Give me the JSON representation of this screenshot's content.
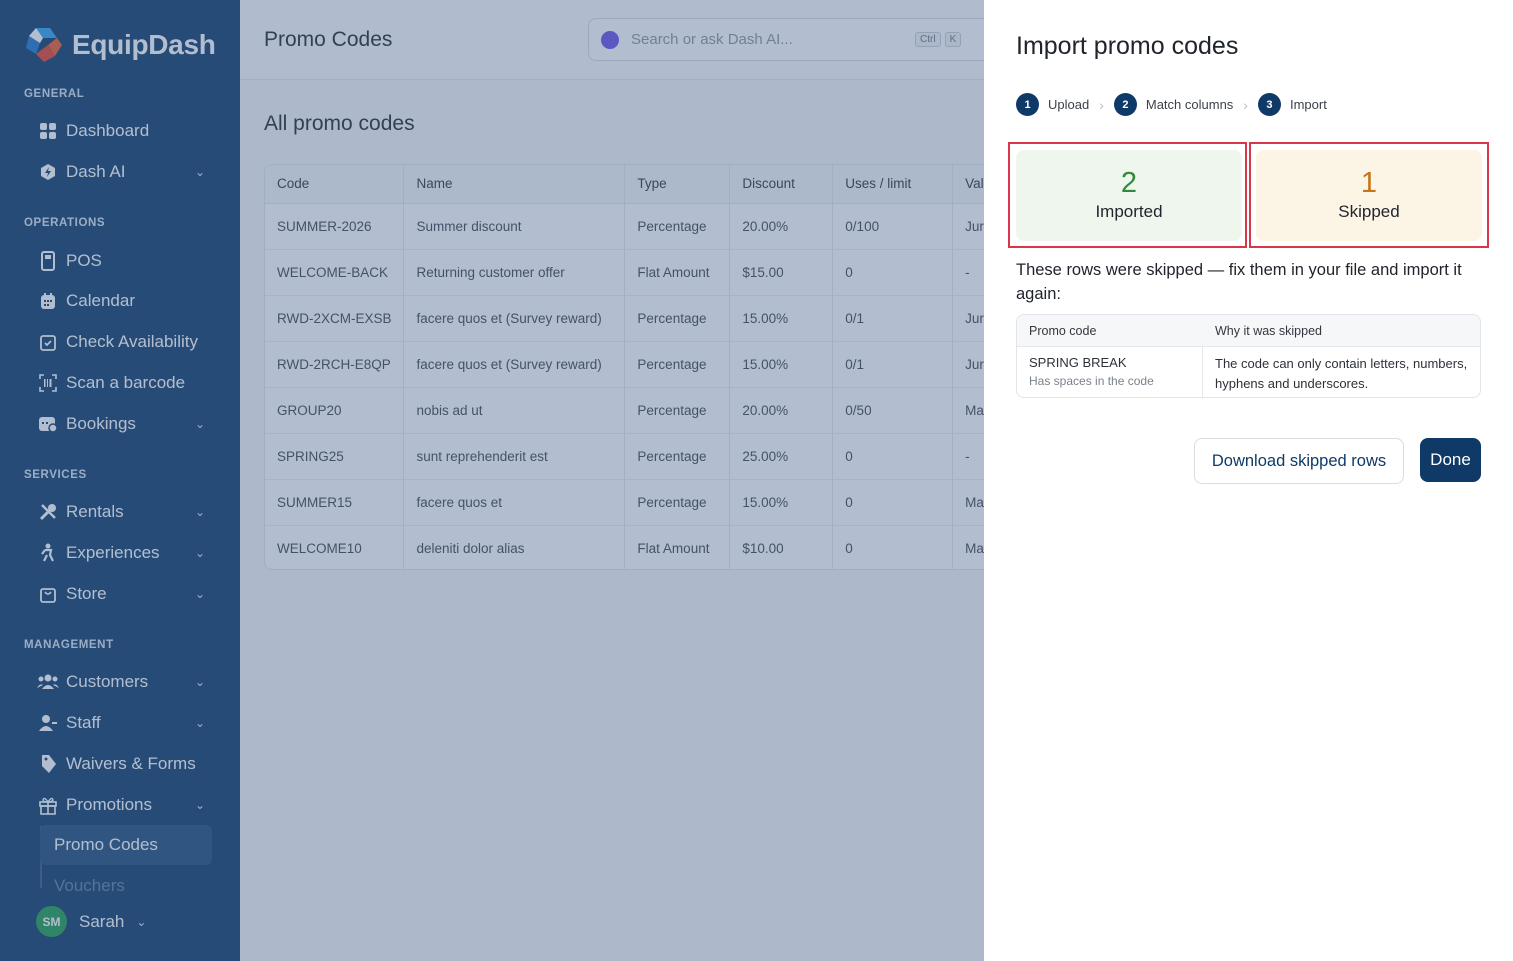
{
  "app": {
    "name": "EquipDash"
  },
  "sidebar": {
    "sections": {
      "general": "GENERAL",
      "operations": "OPERATIONS",
      "services": "SERVICES",
      "management": "MANAGEMENT"
    },
    "items": {
      "dashboard": "Dashboard",
      "dash_ai": "Dash AI",
      "pos": "POS",
      "calendar": "Calendar",
      "check_availability": "Check Availability",
      "scan_barcode": "Scan a barcode",
      "bookings": "Bookings",
      "rentals": "Rentals",
      "experiences": "Experiences",
      "store": "Store",
      "customers": "Customers",
      "staff": "Staff",
      "waivers": "Waivers & Forms",
      "promotions": "Promotions",
      "promo_codes": "Promo Codes",
      "vouchers": "Vouchers"
    },
    "user": {
      "initials": "SM",
      "name": "Sarah"
    }
  },
  "header": {
    "title": "Promo Codes",
    "search_placeholder": "Search or ask Dash AI...",
    "shortcut_ctrl": "Ctrl",
    "shortcut_k": "K"
  },
  "main": {
    "section_title": "All promo codes",
    "columns": [
      "Code",
      "Name",
      "Type",
      "Discount",
      "Uses / limit",
      "Val"
    ],
    "rows": [
      [
        "SUMMER-2026",
        "Summer discount",
        "Percentage",
        "20.00%",
        "0/100",
        "Jur"
      ],
      [
        "WELCOME-BACK",
        "Returning customer offer",
        "Flat Amount",
        "$15.00",
        "0",
        "-"
      ],
      [
        "RWD-2XCM-EXSB",
        "facere quos et (Survey reward)",
        "Percentage",
        "15.00%",
        "0/1",
        "Jur"
      ],
      [
        "RWD-2RCH-E8QP",
        "facere quos et (Survey reward)",
        "Percentage",
        "15.00%",
        "0/1",
        "Jur"
      ],
      [
        "GROUP20",
        "nobis ad ut",
        "Percentage",
        "20.00%",
        "0/50",
        "Ma"
      ],
      [
        "SPRING25",
        "sunt reprehenderit est",
        "Percentage",
        "25.00%",
        "0",
        "-"
      ],
      [
        "SUMMER15",
        "facere quos et",
        "Percentage",
        "15.00%",
        "0",
        "Ma"
      ],
      [
        "WELCOME10",
        "deleniti dolor alias",
        "Flat Amount",
        "$10.00",
        "0",
        "Ma"
      ]
    ]
  },
  "drawer": {
    "title": "Import promo codes",
    "steps": [
      {
        "num": "1",
        "label": "Upload"
      },
      {
        "num": "2",
        "label": "Match columns"
      },
      {
        "num": "3",
        "label": "Import"
      }
    ],
    "stats": {
      "imported_count": "2",
      "imported_label": "Imported",
      "skipped_count": "1",
      "skipped_label": "Skipped"
    },
    "skip_message": "These rows were skipped — fix them in your file and import it again:",
    "skip_table": {
      "col_code": "Promo code",
      "col_reason": "Why it was skipped",
      "rows": [
        {
          "code": "SPRING BREAK",
          "note": "Has spaces in the code",
          "reason": "The code can only contain letters, numbers, hyphens and underscores."
        }
      ]
    },
    "download_label": "Download skipped rows",
    "done_label": "Done"
  },
  "colors": {
    "sidebar_bg": "#0f3a68",
    "accent": "#0f3a68",
    "imported": "#2f8a3a",
    "skipped": "#c6741a",
    "highlight": "#d9364b"
  }
}
